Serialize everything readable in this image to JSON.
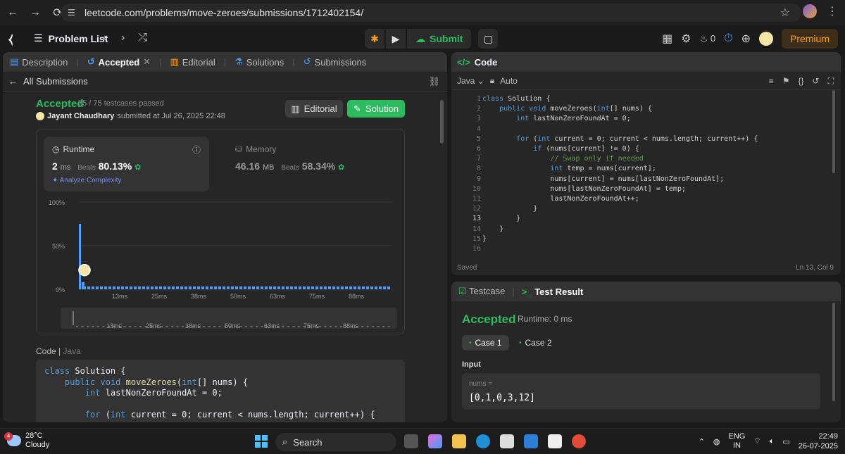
{
  "browser": {
    "url": "leetcode.com/problems/move-zeroes/submissions/1712402154/"
  },
  "header": {
    "problem_list": "Problem List",
    "submit": "Submit",
    "streak": "0",
    "premium": "Premium"
  },
  "left": {
    "tabs": [
      "Description",
      "Accepted",
      "Editorial",
      "Solutions",
      "Submissions"
    ],
    "back_label": "All Submissions",
    "status": "Accepted",
    "testcases": "75 / 75 testcases passed",
    "user": "Jayant Chaudhary",
    "submitted": "submitted at Jul 26, 2025 22:48",
    "editorial_btn": "Editorial",
    "solution_btn": "Solution",
    "runtime_label": "Runtime",
    "runtime_value": "2",
    "runtime_unit": "ms",
    "beats_label": "Beats",
    "runtime_beats": "80.13%",
    "analyze": "Analyze Complexity",
    "memory_label": "Memory",
    "memory_value": "46.16",
    "memory_unit": "MB",
    "memory_beats": "58.34%",
    "code_label": "Code",
    "code_lang": "Java"
  },
  "chart_data": {
    "type": "bar",
    "y_ticks": [
      "100%",
      "50%",
      "0%"
    ],
    "x_ticks": [
      "13ms",
      "25ms",
      "38ms",
      "50ms",
      "63ms",
      "75ms",
      "88ms"
    ],
    "ylim": [
      0,
      100
    ],
    "highlight_value": 75,
    "marker_percent": 22,
    "grid": true
  },
  "code_preview": [
    "class Solution {",
    "    public void moveZeroes(int[] nums) {",
    "        int lastNonZeroFoundAt = 0;",
    "",
    "        for (int current = 0; current < nums.length; current++) {"
  ],
  "editor": {
    "title": "Code",
    "language": "Java",
    "mode": "Auto",
    "lines": [
      "class Solution {",
      "    public void moveZeroes(int[] nums) {",
      "        int lastNonZeroFoundAt = 0;",
      "",
      "        for (int current = 0; current < nums.length; current++) {",
      "            if (nums[current] != 0) {",
      "                // Swap only if needed",
      "                int temp = nums[current];",
      "                nums[current] = nums[lastNonZeroFoundAt];",
      "                nums[lastNonZeroFoundAt] = temp;",
      "                lastNonZeroFoundAt++;",
      "            }",
      "        }",
      "    }",
      "}",
      ""
    ],
    "saved": "Saved",
    "cursor": "Ln 13, Col 9"
  },
  "test": {
    "testcase_tab": "Testcase",
    "result_tab": "Test Result",
    "status": "Accepted",
    "runtime": "Runtime: 0 ms",
    "cases": [
      "Case 1",
      "Case 2"
    ],
    "input_label": "Input",
    "input_name": "nums =",
    "input_value": "[0,1,0,3,12]"
  },
  "taskbar": {
    "temp": "28°C",
    "weather": "Cloudy",
    "badge": "4",
    "search": "Search",
    "lang1": "ENG",
    "lang2": "IN",
    "time": "22:49",
    "date": "26-07-2025"
  }
}
